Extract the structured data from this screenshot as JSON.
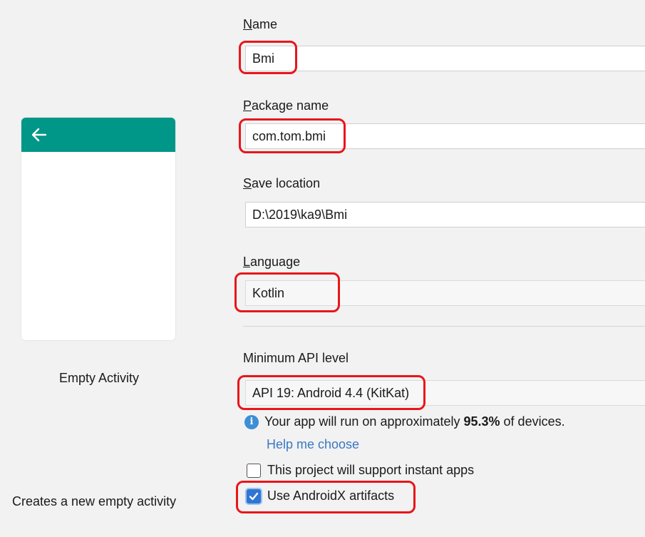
{
  "preview": {
    "back_icon": "arrow-left-icon",
    "template_name": "Empty Activity",
    "template_description": "Creates a new empty activity",
    "toolbar_color": "#009688"
  },
  "form": {
    "name": {
      "label_mnemonic": "N",
      "label_rest": "ame",
      "value": "Bmi"
    },
    "package_name": {
      "label_mnemonic": "P",
      "label_rest": "ackage name",
      "value": "com.tom.bmi"
    },
    "save_location": {
      "label_mnemonic": "S",
      "label_rest": "ave location",
      "value": "D:\\2019\\ka9\\Bmi"
    },
    "language": {
      "label_mnemonic": "L",
      "label_rest": "anguage",
      "value": "Kotlin"
    },
    "min_api": {
      "label": "Minimum API level",
      "value": "API 19: Android 4.4 (KitKat)"
    },
    "info": {
      "icon": "info-icon",
      "text_before": "Your app will run on approximately ",
      "percent": "95.3%",
      "text_after": " of devices."
    },
    "help_link": "Help me choose",
    "instant_apps": {
      "label": "This project will support instant apps",
      "checked": false
    },
    "androidx": {
      "label": "Use AndroidX artifacts",
      "checked": true
    }
  },
  "colors": {
    "highlight": "#e8161b",
    "link": "#3b78c2",
    "checkbox_checked": "#2f75d3",
    "info_icon": "#3d8fd6"
  }
}
